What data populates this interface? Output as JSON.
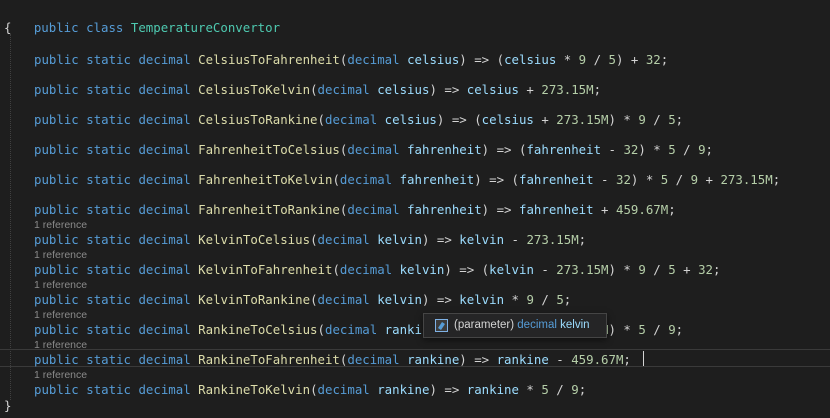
{
  "code": {
    "class_header": {
      "kw1": "public",
      "kw2": "class",
      "name": "TemperatureConvertor"
    },
    "open_brace": "{",
    "close_brace": "}",
    "methods": [
      {
        "name": "CelsiusToFahrenheit",
        "param": "celsius",
        "body": [
          [
            "p",
            "("
          ],
          [
            "v",
            "celsius"
          ],
          [
            "p",
            " * "
          ],
          [
            "n",
            "9"
          ],
          [
            "p",
            " / "
          ],
          [
            "n",
            "5"
          ],
          [
            "p",
            ") + "
          ],
          [
            "n",
            "32"
          ],
          [
            "p",
            ";"
          ]
        ]
      },
      {
        "name": "CelsiusToKelvin",
        "param": "celsius",
        "body": [
          [
            "v",
            "celsius"
          ],
          [
            "p",
            " + "
          ],
          [
            "n",
            "273.15M"
          ],
          [
            "p",
            ";"
          ]
        ]
      },
      {
        "name": "CelsiusToRankine",
        "param": "celsius",
        "body": [
          [
            "p",
            "("
          ],
          [
            "v",
            "celsius"
          ],
          [
            "p",
            " + "
          ],
          [
            "n",
            "273.15M"
          ],
          [
            "p",
            ") * "
          ],
          [
            "n",
            "9"
          ],
          [
            "p",
            " / "
          ],
          [
            "n",
            "5"
          ],
          [
            "p",
            ";"
          ]
        ]
      },
      {
        "name": "FahrenheitToCelsius",
        "param": "fahrenheit",
        "body": [
          [
            "p",
            "("
          ],
          [
            "v",
            "fahrenheit"
          ],
          [
            "p",
            " - "
          ],
          [
            "n",
            "32"
          ],
          [
            "p",
            ") * "
          ],
          [
            "n",
            "5"
          ],
          [
            "p",
            " / "
          ],
          [
            "n",
            "9"
          ],
          [
            "p",
            ";"
          ]
        ]
      },
      {
        "name": "FahrenheitToKelvin",
        "param": "fahrenheit",
        "body": [
          [
            "p",
            "("
          ],
          [
            "v",
            "fahrenheit"
          ],
          [
            "p",
            " - "
          ],
          [
            "n",
            "32"
          ],
          [
            "p",
            ") * "
          ],
          [
            "n",
            "5"
          ],
          [
            "p",
            " / "
          ],
          [
            "n",
            "9"
          ],
          [
            "p",
            " + "
          ],
          [
            "n",
            "273.15M"
          ],
          [
            "p",
            ";"
          ]
        ]
      },
      {
        "name": "FahrenheitToRankine",
        "param": "fahrenheit",
        "body": [
          [
            "v",
            "fahrenheit"
          ],
          [
            "p",
            " + "
          ],
          [
            "n",
            "459.67M"
          ],
          [
            "p",
            ";"
          ]
        ]
      },
      {
        "name": "KelvinToCelsius",
        "param": "kelvin",
        "body": [
          [
            "v",
            "kelvin"
          ],
          [
            "p",
            " - "
          ],
          [
            "n",
            "273.15M"
          ],
          [
            "p",
            ";"
          ]
        ]
      },
      {
        "name": "KelvinToFahrenheit",
        "param": "kelvin",
        "body": [
          [
            "p",
            "("
          ],
          [
            "v",
            "kelvin"
          ],
          [
            "p",
            " - "
          ],
          [
            "n",
            "273.15M"
          ],
          [
            "p",
            ") * "
          ],
          [
            "n",
            "9"
          ],
          [
            "p",
            " / "
          ],
          [
            "n",
            "5"
          ],
          [
            "p",
            " + "
          ],
          [
            "n",
            "32"
          ],
          [
            "p",
            ";"
          ]
        ]
      },
      {
        "name": "KelvinToRankine",
        "param": "kelvin",
        "body": [
          [
            "v",
            "kelvin"
          ],
          [
            "p",
            " * "
          ],
          [
            "n",
            "9"
          ],
          [
            "p",
            " / "
          ],
          [
            "n",
            "5"
          ],
          [
            "p",
            ";"
          ]
        ]
      },
      {
        "name": "RankineToCelsius",
        "param": "rankine",
        "body": [
          [
            "p",
            "("
          ],
          [
            "v",
            "rankine"
          ],
          [
            "p",
            " - "
          ],
          [
            "n",
            "491.67M"
          ],
          [
            "p",
            ") * "
          ],
          [
            "n",
            "5"
          ],
          [
            "p",
            " / "
          ],
          [
            "n",
            "9"
          ],
          [
            "p",
            ";"
          ]
        ]
      },
      {
        "name": "RankineToFahrenheit",
        "param": "rankine",
        "body": [
          [
            "v",
            "rankine"
          ],
          [
            "p",
            " - "
          ],
          [
            "n",
            "459.67M"
          ],
          [
            "p",
            ";"
          ]
        ]
      },
      {
        "name": "RankineToKelvin",
        "param": "rankine",
        "body": [
          [
            "v",
            "rankine"
          ],
          [
            "p",
            " * "
          ],
          [
            "n",
            "5"
          ],
          [
            "p",
            " / "
          ],
          [
            "n",
            "9"
          ],
          [
            "p",
            ";"
          ]
        ]
      }
    ],
    "method_keywords": [
      "public",
      "static",
      "decimal"
    ],
    "param_type": "decimal",
    "arrow": "=>"
  },
  "codelens": {
    "label": "1 reference",
    "count": 6
  },
  "tooltip": {
    "prefix": "(parameter)",
    "type": "decimal",
    "name": "kelvin",
    "icon": "parameter-icon"
  },
  "colors": {
    "background": "#1e1e1e",
    "keyword": "#569cd6",
    "type": "#4ec9b0",
    "method": "#dcdcaa",
    "parameter": "#9cdcfe",
    "number": "#b5cea8"
  }
}
